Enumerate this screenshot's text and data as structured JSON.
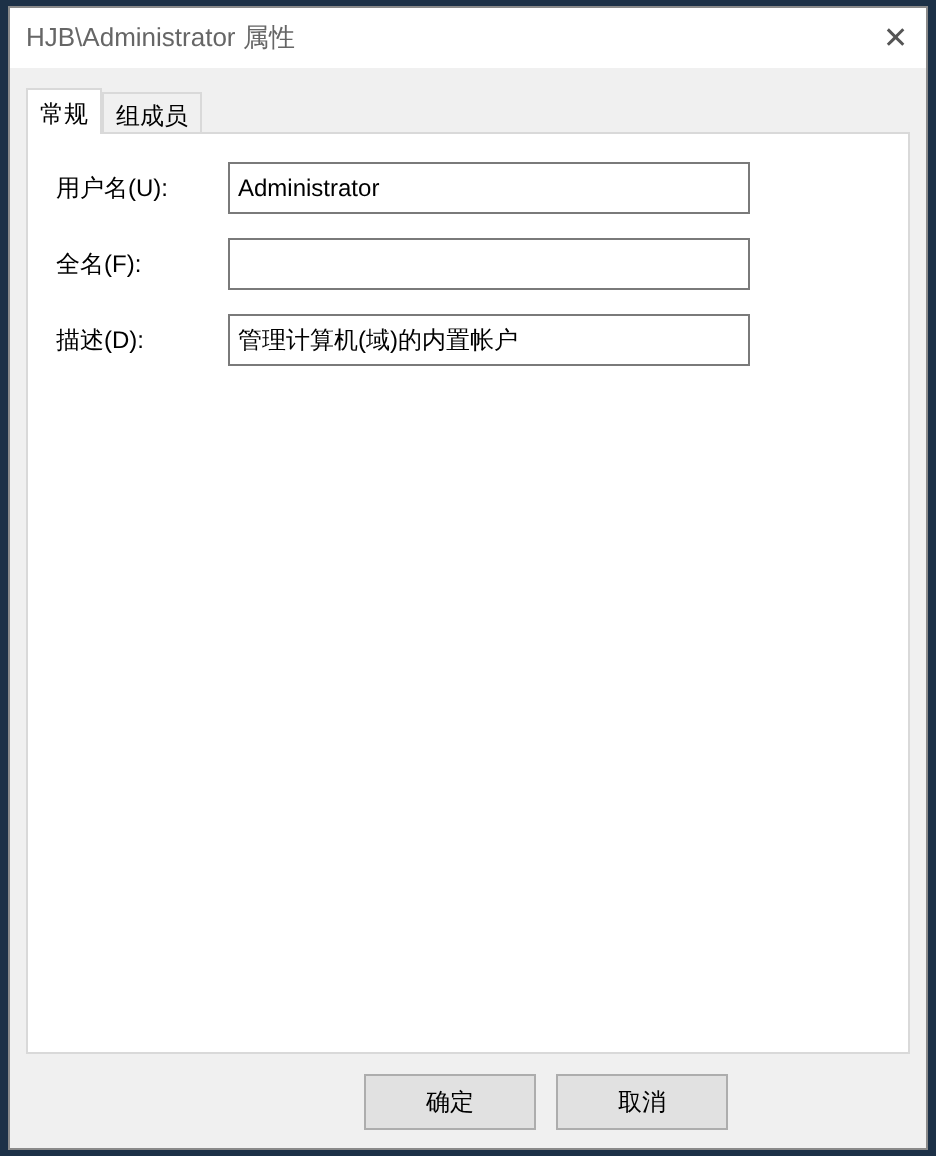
{
  "window": {
    "title": "HJB\\Administrator 属性",
    "close": "✕"
  },
  "tabs": [
    {
      "label": "常规",
      "selected": true
    },
    {
      "label": "组成员",
      "selected": false
    }
  ],
  "fields": [
    {
      "label": "用户名(U):",
      "value": "Administrator"
    },
    {
      "label": "全名(F):"
    },
    {
      "label": "描述(D):",
      "value": "管理计算机(域)的内置帐户"
    }
  ],
  "buttons": [
    "确定",
    "取消"
  ]
}
